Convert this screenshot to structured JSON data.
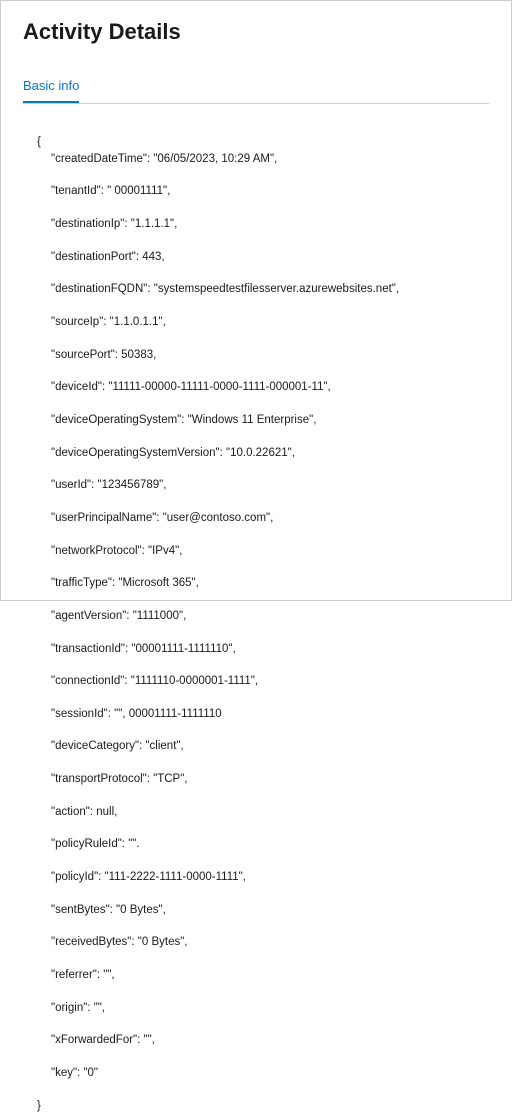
{
  "header": {
    "title": "Activity Details"
  },
  "tabs": {
    "active": "Basic info"
  },
  "details": {
    "createdDateTime": "\"createdDateTime\": \"06/05/2023, 10:29 AM\",",
    "tenantId": "\"tenantId\": \" 00001111\",",
    "destinationIp": "\"destinationIp\": \"1.1.1.1\",",
    "destinationPort": "\"destinationPort\": 443,",
    "destinationFQDN": "\"destinationFQDN\": \"systemspeedtestfilesserver.azurewebsites.net\",",
    "sourceIp": "\"sourceIp\": \"1.1.0.1.1\",",
    "sourcePort": "\"sourcePort\": 50383,",
    "deviceId": "\"deviceId\": \"11111-00000-11111-0000-1111-000001-11\",",
    "deviceOperatingSystem": "\"deviceOperatingSystem\": \"Windows 11 Enterprise\",",
    "deviceOperatingSystemVersion": "\"deviceOperatingSystemVersion\": \"10.0.22621\",",
    "userId": "\"userId\": \"123456789\",",
    "userPrincipalName": "\"userPrincipalName\": \"user@contoso.com\",",
    "networkProtocol": "\"networkProtocol\": \"IPv4\",",
    "trafficType": "\"trafficType\": \"Microsoft 365\",",
    "agentVersion": "\"agentVersion\": \"1111000\",",
    "transactionId": "\"transactionId\": \"00001111-1111110\",",
    "connectionId": "\"connectionId\": \"1111110-0000001-1111\",",
    "sessionId": "\"sessionId\": \"\", 00001111-1111110",
    "deviceCategory": "\"deviceCategory\": \"client\",",
    "transportProtocol": "\"transportProtocol\": \"TCP\",",
    "action": "\"action\": null,",
    "policyRuleId": "\"policyRuleId\": \"\".",
    "policyId": "\"policyId\": \"111-2222-1111-0000-1111\",",
    "sentBytes": "\"sentBytes\": \"0 Bytes\",",
    "receivedBytes": "\"receivedBytes\": \"0 Bytes\",",
    "referrer": "\"referrer\": \"\",",
    "origin": "\"origin\": \"\",",
    "xForwardedFor": "\"xForwardedFor\": \"\",",
    "key": "\"key\": \"0\""
  },
  "braces": {
    "open": "{",
    "close": "}"
  }
}
